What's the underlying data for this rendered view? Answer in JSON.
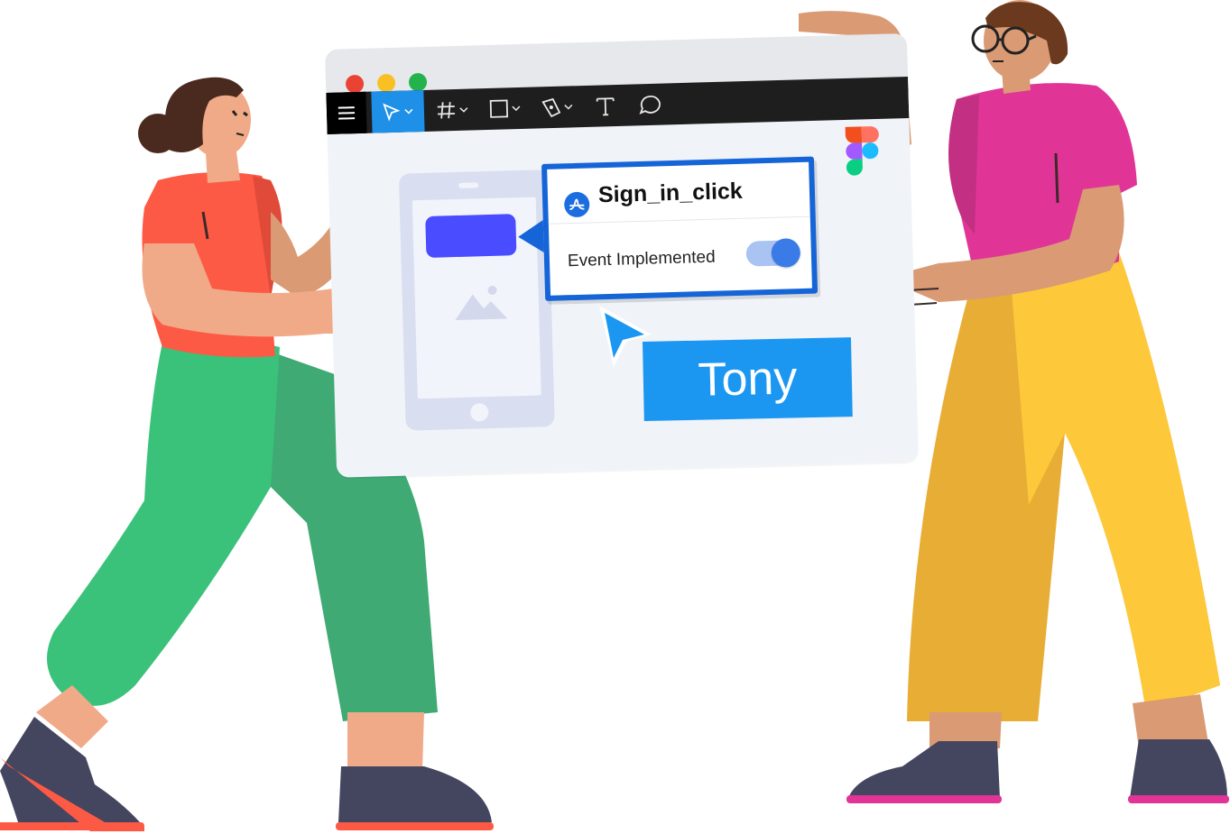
{
  "window": {
    "traffic_lights": {
      "close": "#ea4335",
      "minimize": "#f9c023",
      "maximize": "#23b24b"
    },
    "toolbar_icons": [
      "menu-icon",
      "move-tool-icon",
      "frame-tool-icon",
      "rectangle-tool-icon",
      "pen-tool-icon",
      "text-tool-icon",
      "comment-icon"
    ],
    "brand_icon": "figma-logo"
  },
  "popup": {
    "title": "Sign_in_click",
    "label": "Event Implemented",
    "toggle_on": true,
    "icon": "amplitude-icon",
    "border_color": "#1565d8"
  },
  "cursor": {
    "name_tag": "Tony",
    "color": "#1b97f2"
  },
  "colors": {
    "left_shirt": "#fd5a45",
    "left_pants": "#3ac27a",
    "right_shirt": "#e03596",
    "right_pants": "#fdc83a",
    "skin": "#f1aa88",
    "skin_dark": "#d99a74",
    "shoes": "#444660"
  }
}
